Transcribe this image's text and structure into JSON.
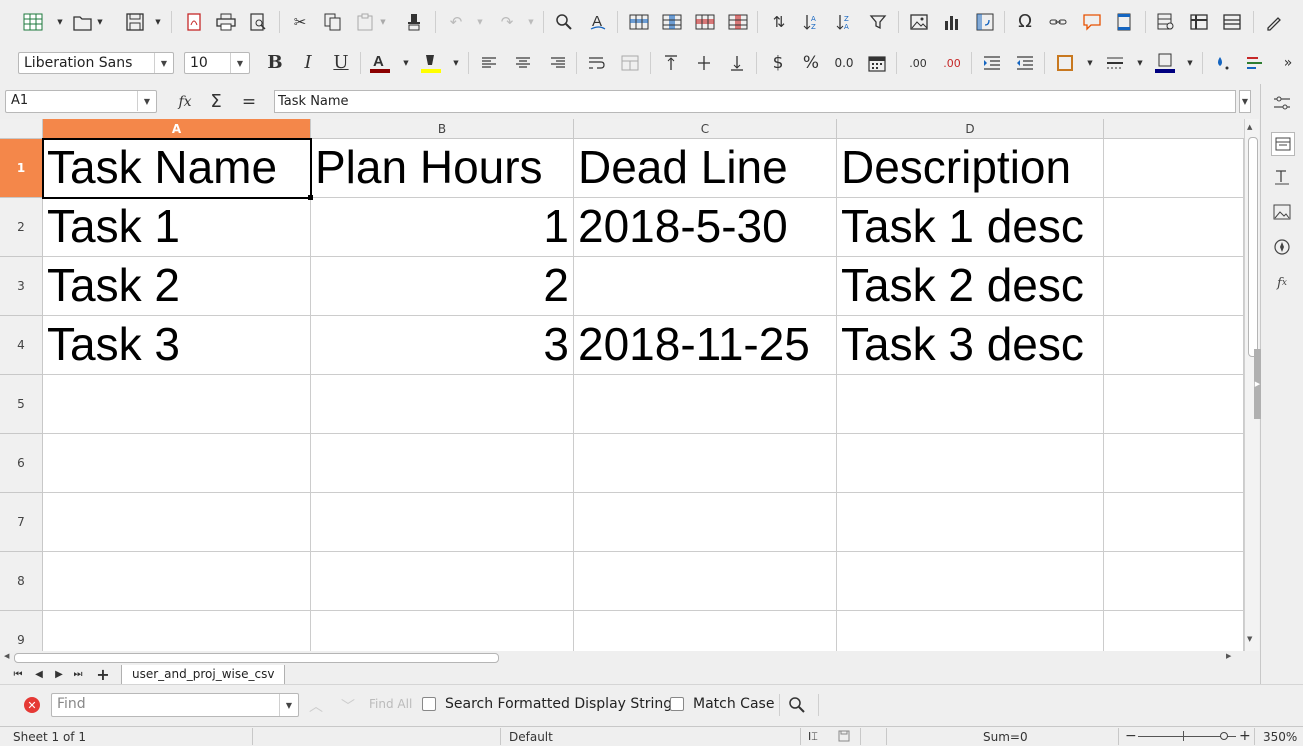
{
  "toolbar_standard": {
    "icons": [
      "new-spreadsheet-icon",
      "open-icon",
      "save-icon",
      "export-pdf-icon",
      "print-icon",
      "print-preview-icon",
      "cut-icon",
      "copy-icon",
      "paste-icon",
      "clone-formatting-icon",
      "undo-icon",
      "redo-icon",
      "find-replace-icon",
      "spelling-icon",
      "row-icon",
      "column-icon",
      "insert-rows-icon",
      "delete-rows-icon",
      "sort-icon",
      "sort-ascending-icon",
      "sort-descending-icon",
      "autofilter-icon",
      "insert-image-icon",
      "insert-chart-icon",
      "pivot-table-icon",
      "special-character-icon",
      "hyperlink-icon",
      "comment-icon",
      "headers-footers-icon",
      "define-print-area-icon",
      "freeze-rows-columns-icon",
      "split-window-icon",
      "show-draw-functions-icon"
    ]
  },
  "toolbar_formatting": {
    "font_name": "Liberation Sans",
    "font_size": "10",
    "bold": "B",
    "italic": "I",
    "underline": "U",
    "font_color": "#8b0000",
    "highlight_color": "#ffff00",
    "currency": "$",
    "percent": "%",
    "number_format": "0.0",
    "add_decimal": ".00",
    "delete_decimal": ".00",
    "border_color": "#000080"
  },
  "formula_bar": {
    "name_box": "A1",
    "function_wizard": "fx",
    "sum": "Σ",
    "formula": "=",
    "content": "Task Name"
  },
  "sheet": {
    "columns": [
      "A",
      "B",
      "C",
      "D"
    ],
    "rows": [
      "1",
      "2",
      "3",
      "4",
      "5",
      "6",
      "7",
      "8",
      "9"
    ],
    "active_cell": "A1",
    "cells": [
      [
        "Task Name",
        "Plan Hours",
        "Dead Line",
        "Description"
      ],
      [
        "Task 1",
        "1",
        "2018-5-30",
        "Task 1 desc"
      ],
      [
        "Task 2",
        "2",
        "",
        "Task 2 desc"
      ],
      [
        "Task 3",
        "3",
        "2018-11-25",
        "Task 3 desc"
      ]
    ]
  },
  "sheet_tabs": {
    "add": "+",
    "tabs": [
      "user_and_proj_wise_csv"
    ]
  },
  "find_bar": {
    "placeholder": "Find",
    "find_all": "Find All",
    "search_formatted": "Search Formatted Display String",
    "match_case": "Match Case"
  },
  "status_bar": {
    "sheet": "Sheet 1 of 1",
    "page_style": "Default",
    "sum": "Sum=0",
    "zoom": "350%"
  },
  "colors": {
    "selected_header": "#f4874a",
    "gridline": "#cccccc",
    "chrome_background": "#efefef"
  }
}
